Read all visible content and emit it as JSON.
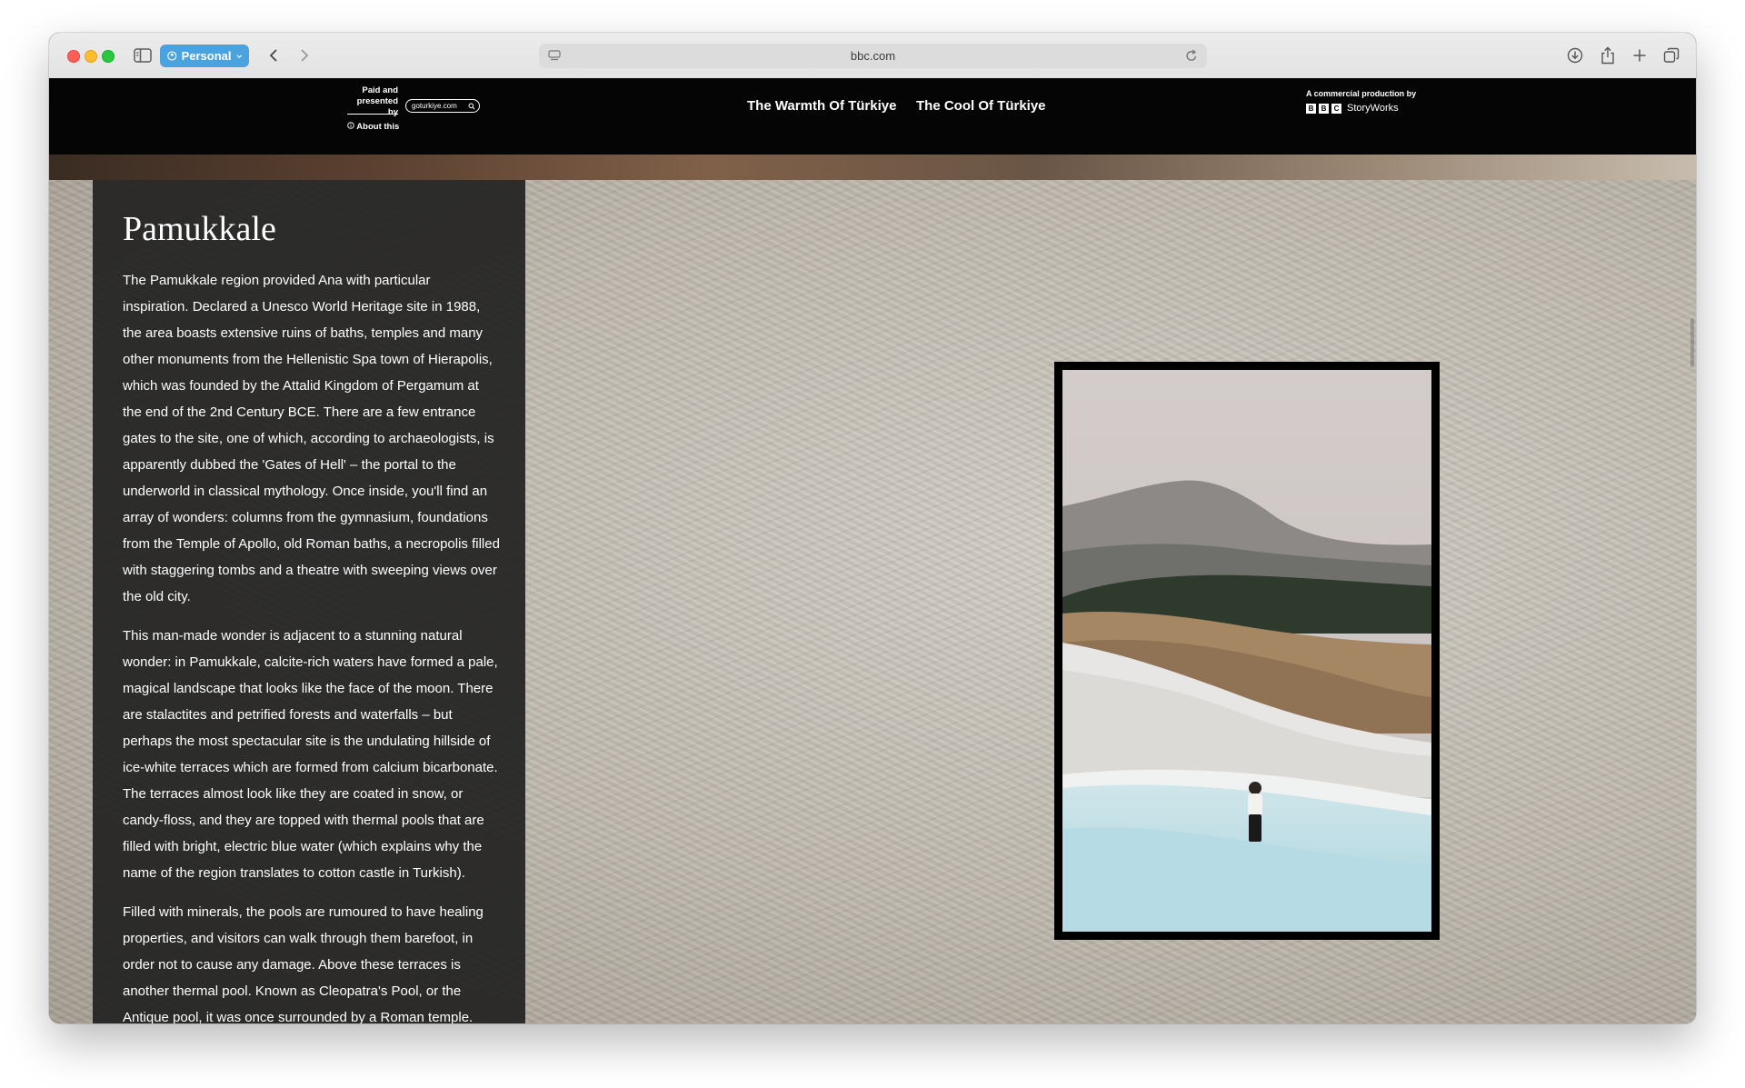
{
  "browser": {
    "profile_label": "Personal",
    "address": "bbc.com"
  },
  "site_header": {
    "paid_by_label": "Paid and presented by",
    "sponsor_logo_text": "goturkiye.com",
    "about_label": "About this",
    "nav": [
      {
        "label": "The Warmth Of Türkiye"
      },
      {
        "label": "The Cool Of Türkiye"
      }
    ],
    "production_label": "A commercial production by",
    "bbc_letters": [
      "B",
      "B",
      "C"
    ],
    "storyworks_label": "StoryWorks"
  },
  "article": {
    "title": "Pamukkale",
    "paragraphs": [
      "The Pamukkale region provided Ana with particular inspiration. Declared a Unesco World Heritage site in 1988, the area boasts extensive ruins of baths, temples and many other monuments from the Hellenistic Spa town of Hierapolis, which was founded by the Attalid Kingdom of Pergamum at the end of the 2nd Century BCE. There are a few entrance gates to the site, one of which, according to archaeologists, is apparently dubbed the 'Gates of Hell' – the portal to the underworld in classical mythology. Once inside, you'll find an array of wonders: columns from the gymnasium, foundations from the Temple of Apollo, old Roman baths, a necropolis filled with staggering tombs and a theatre with sweeping views over the old city.",
      "This man-made wonder is adjacent to a stunning natural wonder: in Pamukkale, calcite-rich waters have formed a pale, magical landscape that looks like the face of the moon. There are stalactites and petrified forests and waterfalls – but perhaps the most spectacular site is the undulating hillside of ice-white terraces which are formed from calcium bicarbonate. The terraces almost look like they are coated in snow, or candy-floss, and they are topped with thermal pools that are filled with bright, electric blue water (which explains why the name of the region translates to cotton castle in Turkish).",
      "Filled with minerals, the pools are rumoured to have healing properties, and visitors can walk through them barefoot, in order not to cause any damage. Above these terraces is another thermal pool. Known as Cleopatra's Pool, or the Antique pool, it was once surrounded by a Roman temple."
    ]
  },
  "colors": {
    "profile_blue": "#4aa3df",
    "header_black": "#050505",
    "panel_dark": "#1e1e1e",
    "pool_blue": "#b9dbe3"
  }
}
